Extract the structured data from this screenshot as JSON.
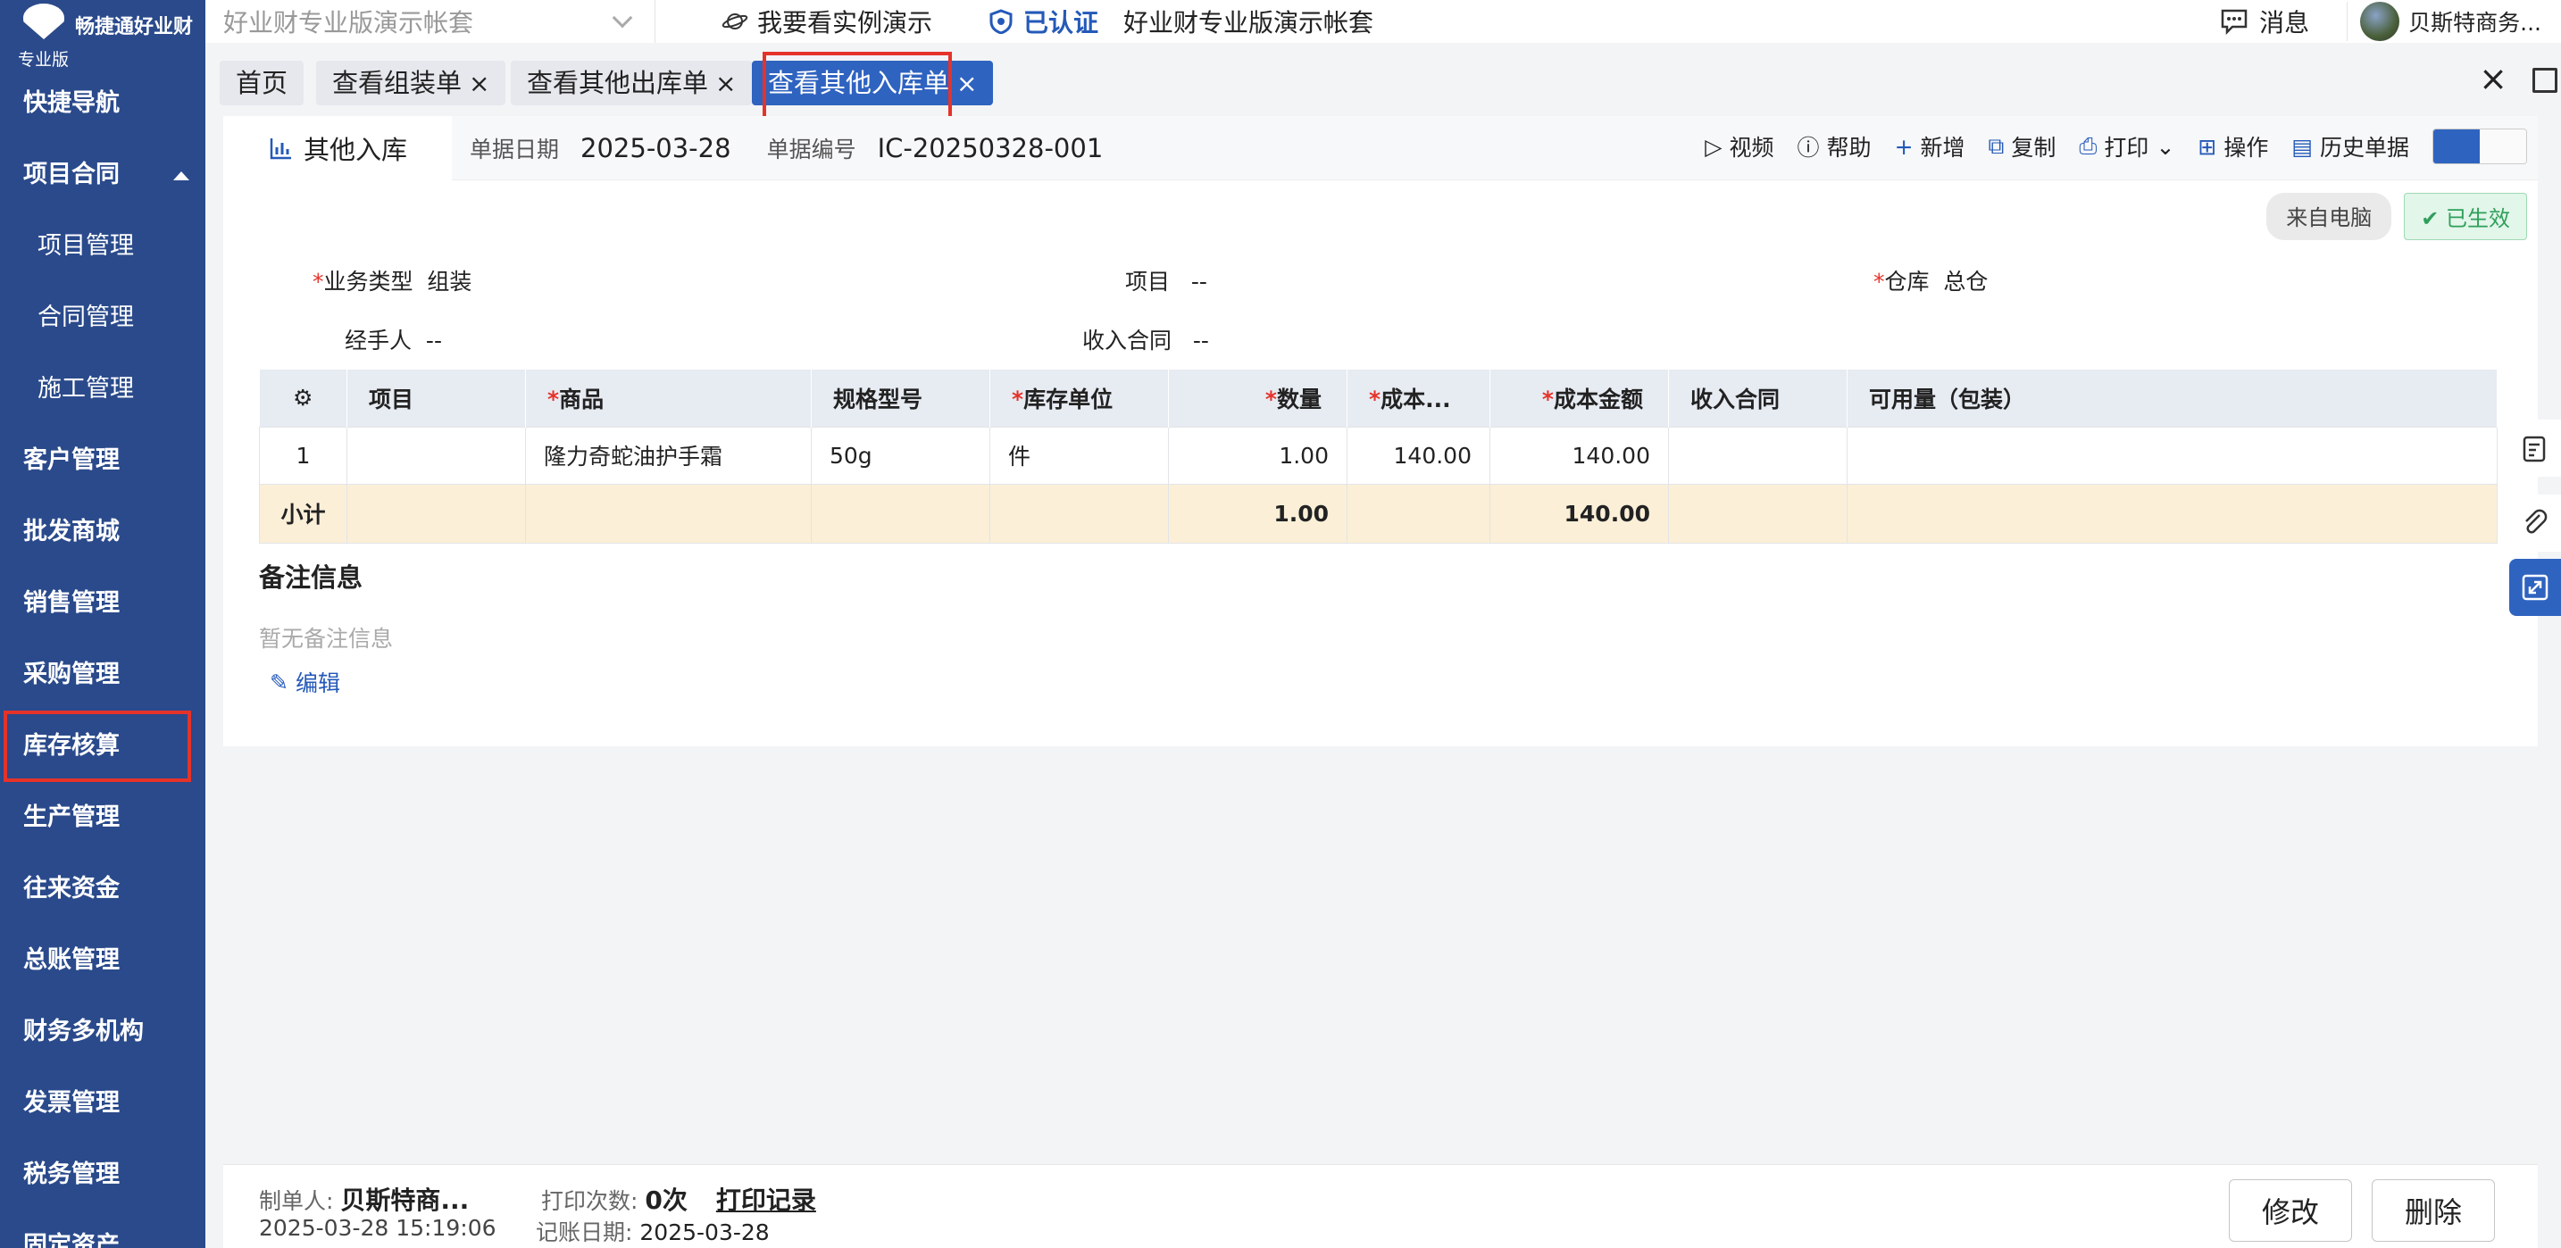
{
  "sidebar": {
    "brand": "畅捷通好业财",
    "edition": "专业版",
    "items": [
      {
        "label": "快捷导航"
      },
      {
        "label": "项目合同"
      },
      {
        "label": "项目管理"
      },
      {
        "label": "合同管理"
      },
      {
        "label": "施工管理"
      },
      {
        "label": "客户管理"
      },
      {
        "label": "批发商城"
      },
      {
        "label": "销售管理"
      },
      {
        "label": "采购管理"
      },
      {
        "label": "库存核算"
      },
      {
        "label": "生产管理"
      },
      {
        "label": "往来资金"
      },
      {
        "label": "总账管理"
      },
      {
        "label": "财务多机构"
      },
      {
        "label": "发票管理"
      },
      {
        "label": "税务管理"
      },
      {
        "label": "固定资产"
      }
    ]
  },
  "topbar": {
    "account_select": "好业财专业版演示帐套",
    "demo_link": "我要看实例演示",
    "verified": "已认证",
    "account_name": "好业财专业版演示帐套",
    "messages": "消息",
    "user": "贝斯特商务..."
  },
  "tabs": [
    {
      "label": "首页"
    },
    {
      "label": "查看组装单"
    },
    {
      "label": "查看其他出库单"
    },
    {
      "label": "查看其他入库单"
    }
  ],
  "doc": {
    "tab_label": "其他入库",
    "date_label": "单据日期",
    "date": "2025-03-28",
    "number_label": "单据编号",
    "number": "IC-20250328-001"
  },
  "actions": {
    "video": "视频",
    "help": "帮助",
    "new": "新增",
    "copy": "复制",
    "print": "打印",
    "operate": "操作",
    "history": "历史单据"
  },
  "status": {
    "source": "来自电脑",
    "state": "已生效"
  },
  "form": {
    "biz_type_label": "业务类型",
    "biz_type": "组装",
    "project_label": "项目",
    "project": "--",
    "warehouse_label": "仓库",
    "warehouse": "总仓",
    "handler_label": "经手人",
    "handler": "--",
    "contract_label": "收入合同",
    "contract": "--"
  },
  "table": {
    "headers": [
      "项目",
      "商品",
      "规格型号",
      "库存单位",
      "数量",
      "成本...",
      "成本金额",
      "收入合同",
      "可用量（包装）"
    ],
    "rows": [
      {
        "idx": "1",
        "project": "",
        "product": "隆力奇蛇油护手霜",
        "spec": "50g",
        "unit": "件",
        "qty": "1.00",
        "cost": "140.00",
        "amount": "140.00",
        "contract": "",
        "avail": ""
      }
    ],
    "subtotal": {
      "label": "小计",
      "qty": "1.00",
      "amount": "140.00"
    }
  },
  "remark": {
    "title": "备注信息",
    "empty": "暂无备注信息",
    "edit": "编辑"
  },
  "footer": {
    "maker_label": "制单人:",
    "maker": "贝斯特商...",
    "created": "2025-03-28 15:19:06",
    "print_count_label": "打印次数:",
    "print_count": "0次",
    "print_log": "打印记录",
    "post_date_label": "记账日期:",
    "post_date": "2025-03-28",
    "modify": "修改",
    "delete": "删除"
  }
}
